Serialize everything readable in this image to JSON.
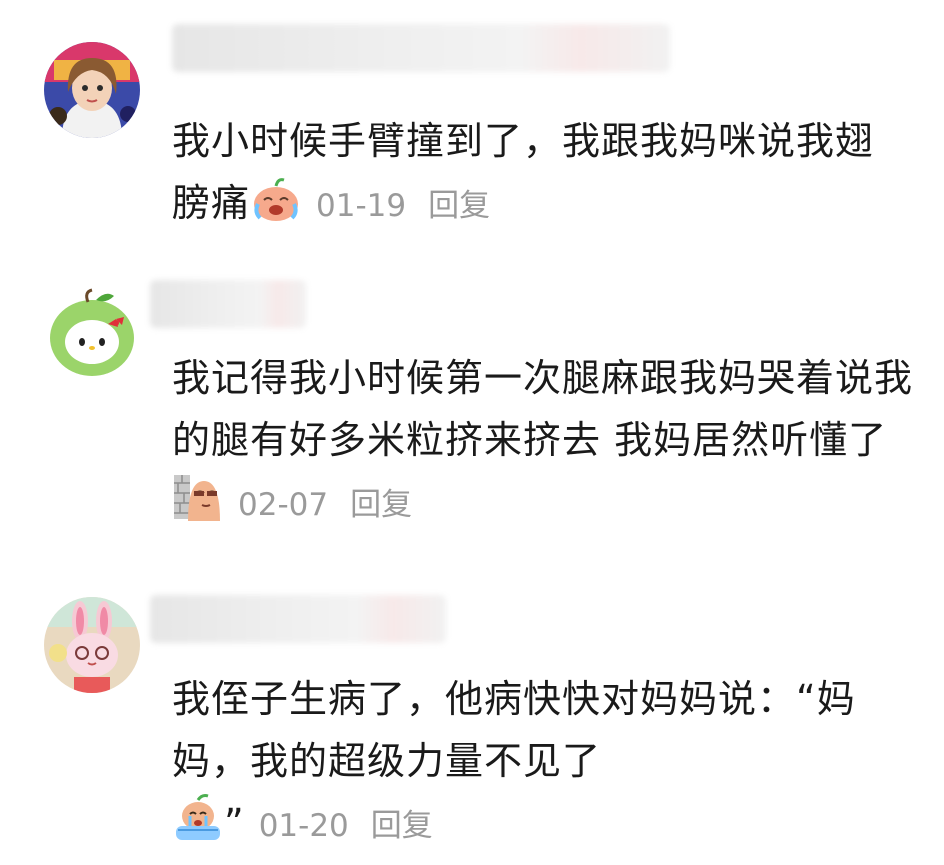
{
  "comments": [
    {
      "avatar": "anime-girl-avatar",
      "text": "我小时候手臂撞到了，我跟我妈咪说我翅膀痛",
      "emoji": "crying-laughing-face-emoji",
      "date": "01-19",
      "reply_label": "回复"
    },
    {
      "avatar": "hello-kitty-apple-avatar",
      "text": "我记得我小时候第一次腿麻跟我妈哭着说我的腿有好多米粒挤来挤去 我妈居然听懂了",
      "emoji": "peeking-wall-emoji",
      "date": "02-07",
      "reply_label": "回复"
    },
    {
      "avatar": "pink-bunny-avatar",
      "text": "我侄子生病了，他病快快对妈妈说：“妈妈，我的超级力量不见了",
      "emoji": "crying-in-tub-emoji",
      "text_after_emoji": "”",
      "date": "01-20",
      "reply_label": "回复"
    }
  ],
  "colors": {
    "text": "#1a1a1a",
    "meta": "#9a9a9a",
    "background": "#ffffff"
  }
}
